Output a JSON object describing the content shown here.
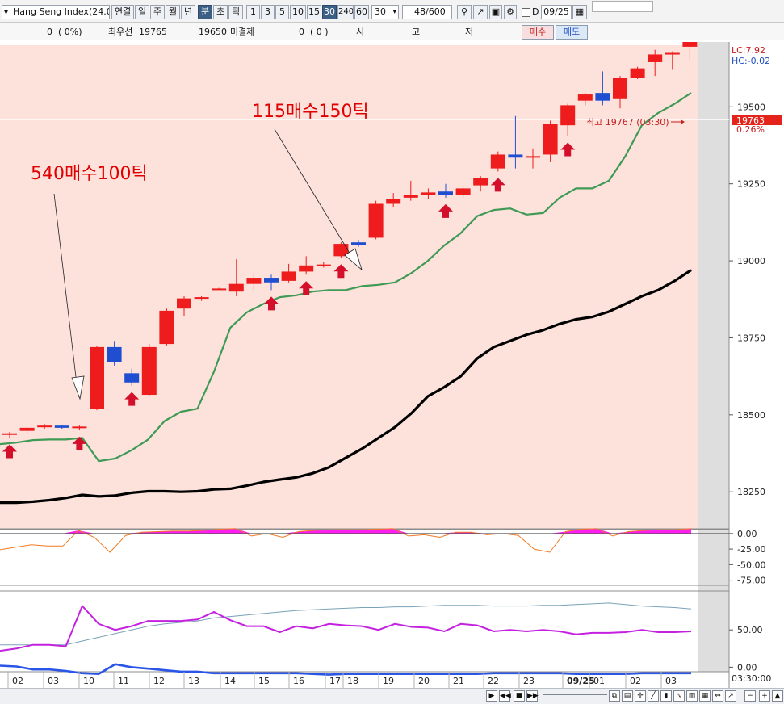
{
  "toolbar": {
    "symbol": "Hang Seng Index(24.0",
    "period_buttons": [
      "연결",
      "일",
      "주",
      "월",
      "년",
      "분",
      "초",
      "틱"
    ],
    "active_period": "분",
    "minute_buttons": [
      "1",
      "3",
      "5",
      "10",
      "15",
      "30",
      "240",
      "60"
    ],
    "active_minute": "30",
    "interval_value": "30",
    "count_value": "48",
    "count_total": "/600",
    "date_checkbox_label": "D",
    "date_value": "09/25"
  },
  "infobar": {
    "change": "0",
    "change_pct": "( 0%)",
    "best_ask_label": "최우선",
    "best_ask": "19765",
    "best_bid": "19650",
    "open_interest_label": "미결제",
    "open_interest": "0",
    "oi_change": "( 0 )",
    "open_label": "시",
    "high_label": "고",
    "low_label": "저",
    "buy_button": "매수",
    "sell_button": "매도"
  },
  "chart_data": [
    {
      "type": "candlestick",
      "panel": "price",
      "x_labels": [
        "02",
        "03",
        "10",
        "11",
        "12",
        "13",
        "14",
        "15",
        "16",
        "17",
        "18",
        "19",
        "20",
        "21",
        "22",
        "23",
        "09/25",
        "01",
        "02",
        "03"
      ],
      "y_ticks": [
        18250,
        18500,
        18750,
        19000,
        19250,
        19500
      ],
      "ylim": [
        18130,
        19700
      ],
      "candles": [
        {
          "o": 18435,
          "h": 18445,
          "l": 18425,
          "c": 18440
        },
        {
          "o": 18448,
          "h": 18460,
          "l": 18440,
          "c": 18458
        },
        {
          "o": 18460,
          "h": 18470,
          "l": 18455,
          "c": 18465
        },
        {
          "o": 18465,
          "h": 18468,
          "l": 18455,
          "c": 18458
        },
        {
          "o": 18458,
          "h": 18465,
          "l": 18450,
          "c": 18462
        },
        {
          "o": 18520,
          "h": 18725,
          "l": 18515,
          "c": 18720
        },
        {
          "o": 18720,
          "h": 18740,
          "l": 18660,
          "c": 18670
        },
        {
          "o": 18635,
          "h": 18650,
          "l": 18595,
          "c": 18605
        },
        {
          "o": 18565,
          "h": 18730,
          "l": 18560,
          "c": 18720
        },
        {
          "o": 18730,
          "h": 18845,
          "l": 18725,
          "c": 18838
        },
        {
          "o": 18845,
          "h": 18885,
          "l": 18820,
          "c": 18878
        },
        {
          "o": 18880,
          "h": 18885,
          "l": 18870,
          "c": 18882
        },
        {
          "o": 18910,
          "h": 18912,
          "l": 18905,
          "c": 18910
        },
        {
          "o": 18900,
          "h": 19005,
          "l": 18885,
          "c": 18925
        },
        {
          "o": 18925,
          "h": 18960,
          "l": 18905,
          "c": 18945
        },
        {
          "o": 18945,
          "h": 18955,
          "l": 18905,
          "c": 18930
        },
        {
          "o": 18935,
          "h": 18990,
          "l": 18930,
          "c": 18965
        },
        {
          "o": 18965,
          "h": 19015,
          "l": 18955,
          "c": 18985
        },
        {
          "o": 18985,
          "h": 18995,
          "l": 18978,
          "c": 18988
        },
        {
          "o": 19015,
          "h": 19060,
          "l": 19010,
          "c": 19055
        },
        {
          "o": 19060,
          "h": 19068,
          "l": 19045,
          "c": 19050
        },
        {
          "o": 19075,
          "h": 19195,
          "l": 19070,
          "c": 19185
        },
        {
          "o": 19185,
          "h": 19220,
          "l": 19175,
          "c": 19200
        },
        {
          "o": 19205,
          "h": 19260,
          "l": 19195,
          "c": 19215
        },
        {
          "o": 19215,
          "h": 19235,
          "l": 19200,
          "c": 19222
        },
        {
          "o": 19225,
          "h": 19250,
          "l": 19205,
          "c": 19215
        },
        {
          "o": 19215,
          "h": 19240,
          "l": 19205,
          "c": 19235
        },
        {
          "o": 19245,
          "h": 19275,
          "l": 19225,
          "c": 19270
        },
        {
          "o": 19300,
          "h": 19355,
          "l": 19290,
          "c": 19345
        },
        {
          "o": 19345,
          "h": 19470,
          "l": 19300,
          "c": 19335
        },
        {
          "o": 19335,
          "h": 19365,
          "l": 19300,
          "c": 19340
        },
        {
          "o": 19345,
          "h": 19455,
          "l": 19320,
          "c": 19445
        },
        {
          "o": 19440,
          "h": 19510,
          "l": 19405,
          "c": 19505
        },
        {
          "o": 19520,
          "h": 19545,
          "l": 19505,
          "c": 19540
        },
        {
          "o": 19545,
          "h": 19615,
          "l": 19505,
          "c": 19520
        },
        {
          "o": 19525,
          "h": 19600,
          "l": 19495,
          "c": 19595
        },
        {
          "o": 19595,
          "h": 19630,
          "l": 19590,
          "c": 19625
        },
        {
          "o": 19645,
          "h": 19685,
          "l": 19600,
          "c": 19670
        },
        {
          "o": 19670,
          "h": 19680,
          "l": 19620,
          "c": 19675
        },
        {
          "o": 19695,
          "h": 19705,
          "l": 19655,
          "c": 19740
        }
      ],
      "ma_green": [
        18405,
        18410,
        18418,
        18420,
        18420,
        18425,
        18350,
        18358,
        18385,
        18420,
        18480,
        18510,
        18520,
        18640,
        18783,
        18833,
        18860,
        18882,
        18888,
        18900,
        18905,
        18905,
        18918,
        18922,
        18930,
        18960,
        19000,
        19050,
        19090,
        19145,
        19165,
        19170,
        19150,
        19155,
        19205,
        19235,
        19235,
        19260,
        19340,
        19440,
        19480,
        19510,
        19545
      ],
      "ma_black": [
        18215,
        18215,
        18218,
        18223,
        18230,
        18240,
        18235,
        18238,
        18247,
        18252,
        18252,
        18250,
        18252,
        18258,
        18260,
        18270,
        18282,
        18290,
        18297,
        18310,
        18330,
        18360,
        18390,
        18425,
        18460,
        18505,
        18560,
        18590,
        18625,
        18683,
        18720,
        18740,
        18760,
        18775,
        18795,
        18810,
        18818,
        18835,
        18860,
        18885,
        18905,
        18935,
        18970
      ],
      "buy_arrows_at": [
        0,
        4,
        7,
        15,
        17,
        19,
        25,
        28,
        32
      ],
      "annotations": [
        {
          "text": "540매수100틱"
        },
        {
          "text": "115매수150틱"
        },
        {
          "text": "최고 19767 (03:30)"
        }
      ],
      "last_price": "19763",
      "last_change_pct": "0.26%",
      "lc": "LC:7.92",
      "hc": "HC:-0.02"
    },
    {
      "type": "area",
      "panel": "oscillator",
      "y_ticks": [
        "0.00",
        "-25.00",
        "-50.00",
        "-75.00"
      ],
      "ylim": [
        -82,
        5
      ],
      "values": [
        -26,
        -22,
        -18,
        -20,
        -20,
        5,
        -6,
        -30,
        -3,
        2,
        3,
        4,
        4,
        5,
        7,
        8,
        -4,
        0,
        -6,
        3,
        5,
        6,
        6,
        6,
        7,
        8,
        -4,
        -2,
        -6,
        2,
        2,
        -2,
        0,
        -3,
        -25,
        -30,
        3,
        7,
        8,
        -4,
        3,
        5,
        6,
        6,
        8
      ]
    },
    {
      "type": "line",
      "panel": "stochastic",
      "y_ticks": [
        "50.00",
        "0.00"
      ],
      "ylim": [
        -5,
        100
      ],
      "series": [
        {
          "values": [
            30,
            30,
            30,
            30,
            30,
            35,
            40,
            45,
            50,
            55,
            58,
            60,
            62,
            66,
            68,
            70,
            72,
            74,
            76,
            77,
            78,
            79,
            80,
            80,
            81,
            81,
            82,
            83,
            83,
            83,
            82,
            82,
            82,
            83,
            83,
            84,
            85,
            86,
            84,
            82,
            81,
            80,
            78
          ]
        },
        {
          "values": [
            22,
            25,
            30,
            30,
            28,
            82,
            58,
            50,
            55,
            62,
            62,
            62,
            64,
            74,
            63,
            55,
            55,
            47,
            55,
            52,
            58,
            56,
            55,
            50,
            58,
            54,
            53,
            48,
            58,
            56,
            48,
            50,
            48,
            50,
            48,
            44,
            46,
            46,
            47,
            50,
            47,
            47,
            48
          ]
        },
        {
          "values": [
            2,
            1,
            -3,
            -3,
            -5,
            -8,
            -9,
            4,
            0,
            -2,
            -4,
            -6,
            -6,
            -8,
            -8,
            -8,
            -8,
            -8,
            -8,
            -9,
            -10,
            -9,
            -9,
            -9,
            -9,
            -9,
            -9,
            -9,
            -9,
            -9,
            -8,
            -8,
            -8,
            -8,
            -8,
            -9,
            -9,
            -9,
            -9,
            -8,
            -8,
            -8,
            -8
          ]
        }
      ]
    }
  ],
  "footer": {
    "time_label": "03:30:00"
  }
}
